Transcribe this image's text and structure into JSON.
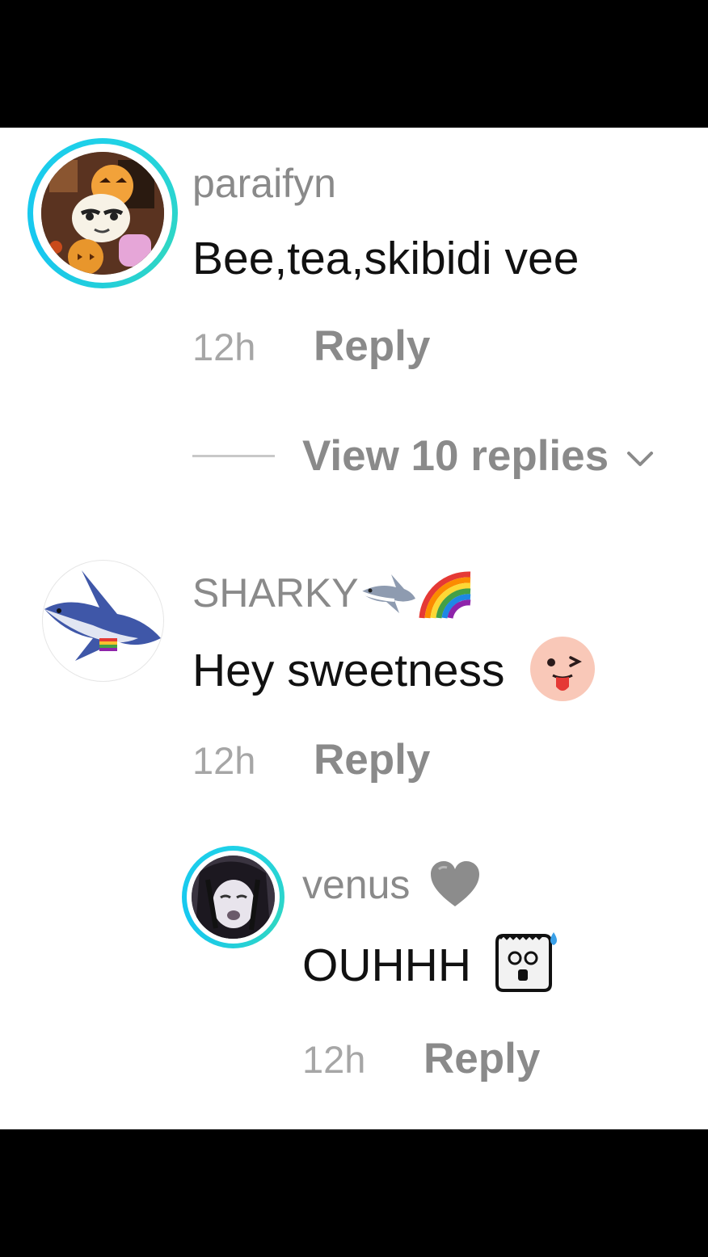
{
  "comments": [
    {
      "username": "paraifyn",
      "text": "Bee,tea,skibidi vee",
      "time": "12h",
      "reply_label": "Reply",
      "avatar_ring": true
    },
    {
      "username": "SHARKY",
      "username_emojis": [
        "shark-emoji",
        "rainbow-emoji"
      ],
      "text": "Hey sweetness",
      "text_emoji": "winking-tongue-face-emoji",
      "time": "12h",
      "reply_label": "Reply",
      "avatar_ring": false
    },
    {
      "username": "venus",
      "username_emoji": "grey-heart-emoji",
      "text": "OUHHH",
      "text_emoji": "shocked-ghost-sticker-emoji",
      "time": "12h",
      "reply_label": "Reply",
      "avatar_ring": true,
      "is_reply": true
    }
  ],
  "view_replies": {
    "label": "View 10 replies",
    "icon": "chevron-down-icon"
  },
  "colors": {
    "ring": "#1fd1e8",
    "username": "#8a8a8a",
    "comment": "#111111",
    "meta": "#a6a6a6"
  }
}
